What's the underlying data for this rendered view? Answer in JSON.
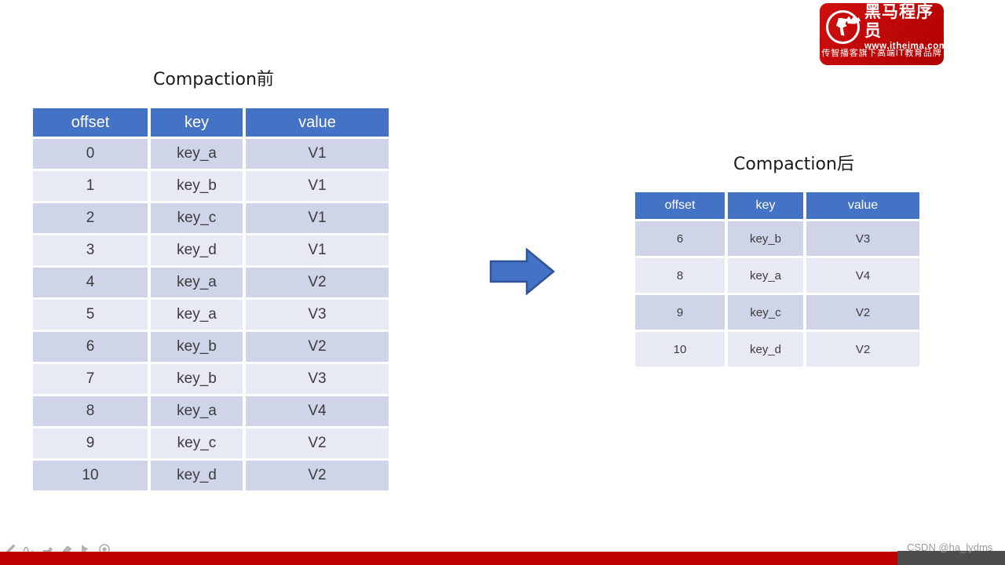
{
  "brand": {
    "name_cn": "黑马程序员",
    "url": "www.itheima.com",
    "slogan": "传智播客旗下高端IT教育品牌",
    "bg_color": "#c00000",
    "logo_icon": "horse-emblem-icon"
  },
  "titles": {
    "before": "Compaction前",
    "after": "Compaction后"
  },
  "arrow": {
    "icon": "right-arrow-icon",
    "fill": "#4472c4",
    "stroke": "#2f5597"
  },
  "table_before": {
    "headers": [
      "offset",
      "key",
      "value"
    ],
    "rows": [
      [
        "0",
        "key_a",
        "V1"
      ],
      [
        "1",
        "key_b",
        "V1"
      ],
      [
        "2",
        "key_c",
        "V1"
      ],
      [
        "3",
        "key_d",
        "V1"
      ],
      [
        "4",
        "key_a",
        "V2"
      ],
      [
        "5",
        "key_a",
        "V3"
      ],
      [
        "6",
        "key_b",
        "V2"
      ],
      [
        "7",
        "key_b",
        "V3"
      ],
      [
        "8",
        "key_a",
        "V4"
      ],
      [
        "9",
        "key_c",
        "V2"
      ],
      [
        "10",
        "key_d",
        "V2"
      ]
    ]
  },
  "table_after": {
    "headers": [
      "offset",
      "key",
      "value"
    ],
    "rows": [
      [
        "6",
        "key_b",
        "V3"
      ],
      [
        "8",
        "key_a",
        "V4"
      ],
      [
        "9",
        "key_c",
        "V2"
      ],
      [
        "10",
        "key_d",
        "V2"
      ]
    ]
  },
  "ink_toolbar": {
    "tools": [
      {
        "name": "pen-icon"
      },
      {
        "name": "squiggle-ink-icon"
      },
      {
        "name": "highlighter-icon"
      },
      {
        "name": "eraser-icon"
      },
      {
        "name": "pointer-icon"
      },
      {
        "name": "laser-pointer-icon"
      }
    ]
  },
  "footer": {
    "watermark": "CSDN @ha_lydms",
    "bar_color": "#c00000",
    "block_color": "#4c4c4c"
  },
  "theme": {
    "header_blue": "#4472c4",
    "band_dark": "#d0d4e8",
    "band_light": "#e7eaf4"
  }
}
